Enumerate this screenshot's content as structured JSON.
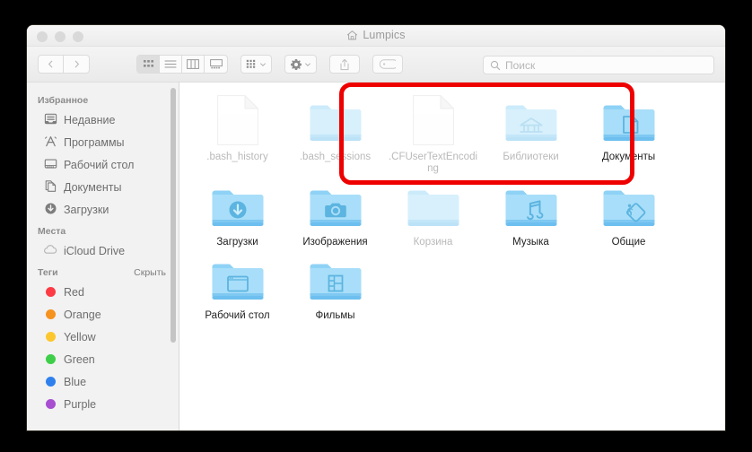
{
  "window": {
    "title": "Lumpics",
    "title_icon": "home-icon",
    "traffic_lights": [
      "close",
      "minimize",
      "zoom"
    ]
  },
  "toolbar": {
    "back_label": "‹",
    "forward_label": "›",
    "view_buttons": [
      {
        "name": "icon-view",
        "active": true
      },
      {
        "name": "list-view",
        "active": false
      },
      {
        "name": "column-view",
        "active": false
      },
      {
        "name": "gallery-view",
        "active": false
      }
    ],
    "arrange_label": "arrange-icon",
    "action_label": "gear-icon",
    "share_label": "share-icon",
    "tags_label": "tag-icon"
  },
  "search": {
    "placeholder": "Поиск",
    "value": ""
  },
  "sidebar": {
    "sections": [
      {
        "title": "Избранное",
        "action": "",
        "items": [
          {
            "label": "Недавние",
            "icon": "recents-icon"
          },
          {
            "label": "Программы",
            "icon": "applications-icon"
          },
          {
            "label": "Рабочий стол",
            "icon": "desktop-icon"
          },
          {
            "label": "Документы",
            "icon": "documents-icon"
          },
          {
            "label": "Загрузки",
            "icon": "downloads-icon"
          }
        ]
      },
      {
        "title": "Места",
        "action": "",
        "items": [
          {
            "label": "iCloud Drive",
            "icon": "icloud-icon"
          }
        ]
      },
      {
        "title": "Теги",
        "action": "Скрыть",
        "items": [
          {
            "label": "Red",
            "icon": "tag-dot-icon",
            "color": "#fc3b44"
          },
          {
            "label": "Orange",
            "icon": "tag-dot-icon",
            "color": "#f6921e"
          },
          {
            "label": "Yellow",
            "icon": "tag-dot-icon",
            "color": "#fcc72e"
          },
          {
            "label": "Green",
            "icon": "tag-dot-icon",
            "color": "#3ecf4a"
          },
          {
            "label": "Blue",
            "icon": "tag-dot-icon",
            "color": "#2f80ed"
          },
          {
            "label": "Purple",
            "icon": "tag-dot-icon",
            "color": "#a74ed1"
          }
        ]
      }
    ]
  },
  "files": {
    "rows": [
      [
        {
          "label": ".bash_history",
          "kind": "file",
          "hidden": true
        },
        {
          "label": ".bash_sessions",
          "kind": "folder-plain",
          "hidden": true
        },
        {
          "label": ".CFUserTextEncoding",
          "kind": "file",
          "hidden": true
        },
        {
          "label": "Библиотеки",
          "kind": "folder-library",
          "hidden": true
        },
        {
          "label": "Документы",
          "kind": "folder-documents",
          "hidden": false
        }
      ],
      [
        {
          "label": "Загрузки",
          "kind": "folder-downloads",
          "hidden": false
        },
        {
          "label": "Изображения",
          "kind": "folder-pictures",
          "hidden": false
        },
        {
          "label": "Корзина",
          "kind": "folder-plain",
          "hidden": true
        },
        {
          "label": "Музыка",
          "kind": "folder-music",
          "hidden": false
        },
        {
          "label": "Общие",
          "kind": "folder-public",
          "hidden": false
        }
      ],
      [
        {
          "label": "Рабочий стол",
          "kind": "folder-desktop",
          "hidden": false
        },
        {
          "label": "Фильмы",
          "kind": "folder-movies",
          "hidden": false
        }
      ]
    ]
  },
  "annotation": {
    "highlight_color": "#ee0000",
    "covers": [
      ".bash_history",
      ".bash_sessions",
      ".CFUserTextEncoding"
    ]
  }
}
